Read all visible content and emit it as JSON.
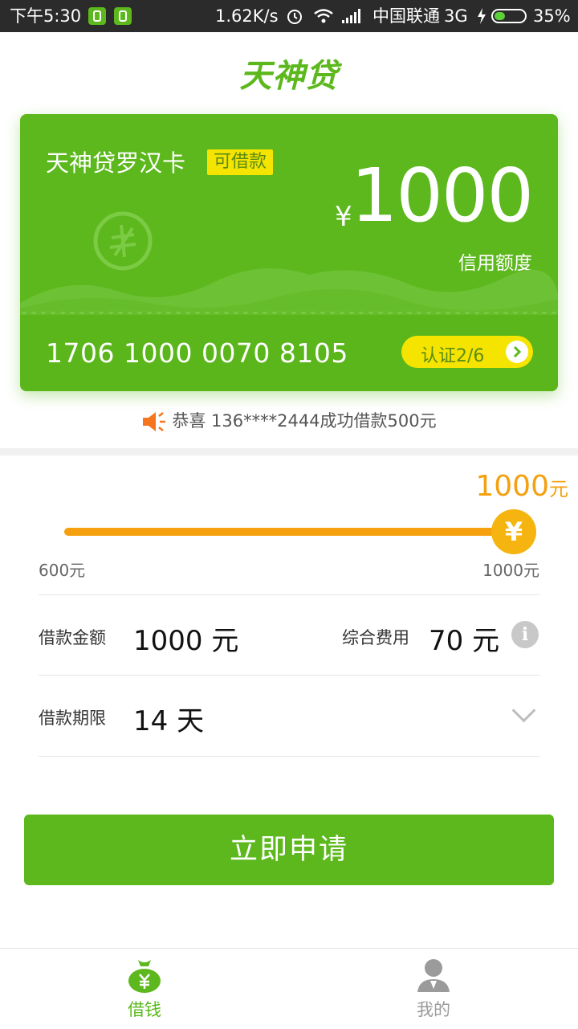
{
  "status_bar": {
    "time": "下午5:30",
    "network_speed": "1.62K/s",
    "carrier": "中国联通",
    "network_type": "3G",
    "battery": "35%",
    "battery_level": 0.35
  },
  "header": {
    "logo_text": "天神贷"
  },
  "card": {
    "title": "天神贷罗汉卡",
    "badge": "可借款",
    "currency": "¥",
    "amount": "1000",
    "limit_label": "信用额度",
    "card_number": "1706 1000 0070 8105",
    "certification": "认证2/6"
  },
  "notice": {
    "text": "恭喜 136****2444成功借款500元"
  },
  "slider": {
    "value": "1000",
    "unit": "元",
    "min_label": "600元",
    "max_label": "1000元",
    "min": 600,
    "max": 1000,
    "current": 1000,
    "thumb_symbol": "¥"
  },
  "loan": {
    "amount_label": "借款金额",
    "amount_value": "1000 元",
    "fee_label": "综合费用",
    "fee_value": "70 元",
    "info_symbol": "i",
    "term_label": "借款期限",
    "term_value": "14 天"
  },
  "apply_button": {
    "label": "立即申请"
  },
  "tabs": [
    {
      "label": "借钱",
      "icon": "money-bag-icon",
      "active": true
    },
    {
      "label": "我的",
      "icon": "user-icon",
      "active": false
    }
  ],
  "colors": {
    "brand_green": "#5cb81d",
    "accent_orange": "#f5a00f",
    "badge_yellow": "#f5e400",
    "inactive_gray": "#9b9b9b"
  }
}
